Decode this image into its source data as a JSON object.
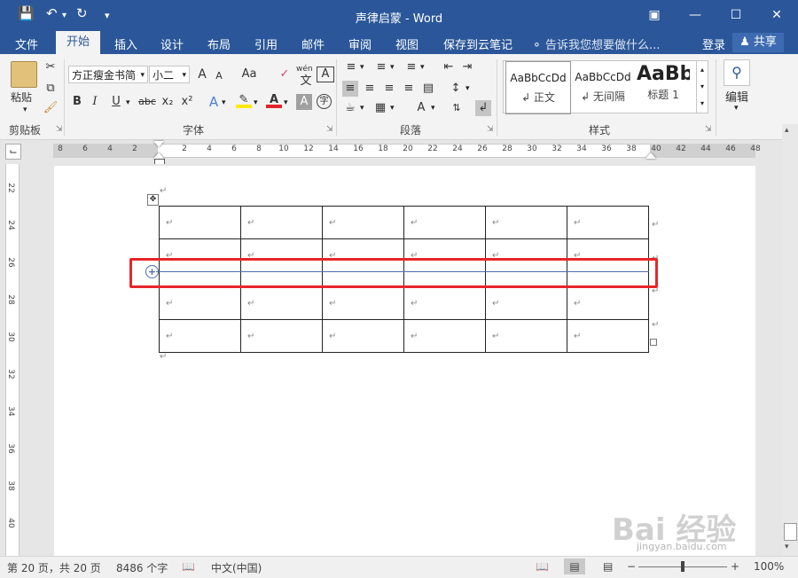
{
  "window": {
    "title": "声律启蒙 - Word",
    "save_icon": "save-icon",
    "undo_icon": "undo-icon",
    "redo_icon": "redo-icon"
  },
  "tabs": [
    "文件",
    "开始",
    "插入",
    "设计",
    "布局",
    "引用",
    "邮件",
    "审阅",
    "视图",
    "保存到云笔记"
  ],
  "active_tab": "开始",
  "tell_me": "告诉我您想要做什么...",
  "account": {
    "login": "登录",
    "share": "共享"
  },
  "ribbon": {
    "clipboard": {
      "paste_label": "粘贴",
      "group_label": "剪贴板"
    },
    "font": {
      "font_name": "方正瘦金书简",
      "font_size": "小二",
      "group_label": "字体",
      "bold": "B",
      "italic": "I",
      "underline": "U",
      "strike": "abc",
      "sub": "x₂",
      "sup": "x²",
      "grow": "A",
      "shrink": "A",
      "case": "Aa",
      "phonetic": "wén",
      "phonetic_char": "文",
      "border_char": "A",
      "enclose_char": "字"
    },
    "paragraph": {
      "group_label": "段落"
    },
    "styles": {
      "group_label": "样式",
      "items": [
        {
          "preview": "AaBbCcDd",
          "name": "↲ 正文"
        },
        {
          "preview": "AaBbCcDd",
          "name": "↲ 无间隔"
        },
        {
          "preview": "AaBb",
          "name": "标题 1"
        }
      ]
    },
    "editing": {
      "label": "编辑"
    }
  },
  "ruler": {
    "h_numbers": [
      "8",
      "6",
      "4",
      "2",
      "2",
      "4",
      "6",
      "8",
      "10",
      "12",
      "14",
      "16",
      "18",
      "20",
      "22",
      "24",
      "26",
      "28",
      "30",
      "32",
      "34",
      "36",
      "38",
      "40",
      "42",
      "44",
      "46",
      "48"
    ],
    "v_numbers": [
      "22",
      "24",
      "26",
      "28",
      "30",
      "32",
      "34",
      "36",
      "38",
      "40"
    ]
  },
  "document": {
    "paragraph_mark": "↵",
    "table_rows": 5,
    "table_cols": 6
  },
  "statusbar": {
    "page": "第 20 页，共 20 页",
    "words": "8486 个字",
    "language": "中文(中国)",
    "zoom": "100%"
  },
  "watermark": {
    "brand": "Bai 经验",
    "url": "jingyan.baidu.com"
  },
  "colors": {
    "accent": "#2b579a",
    "highlight": "#e8262b"
  }
}
